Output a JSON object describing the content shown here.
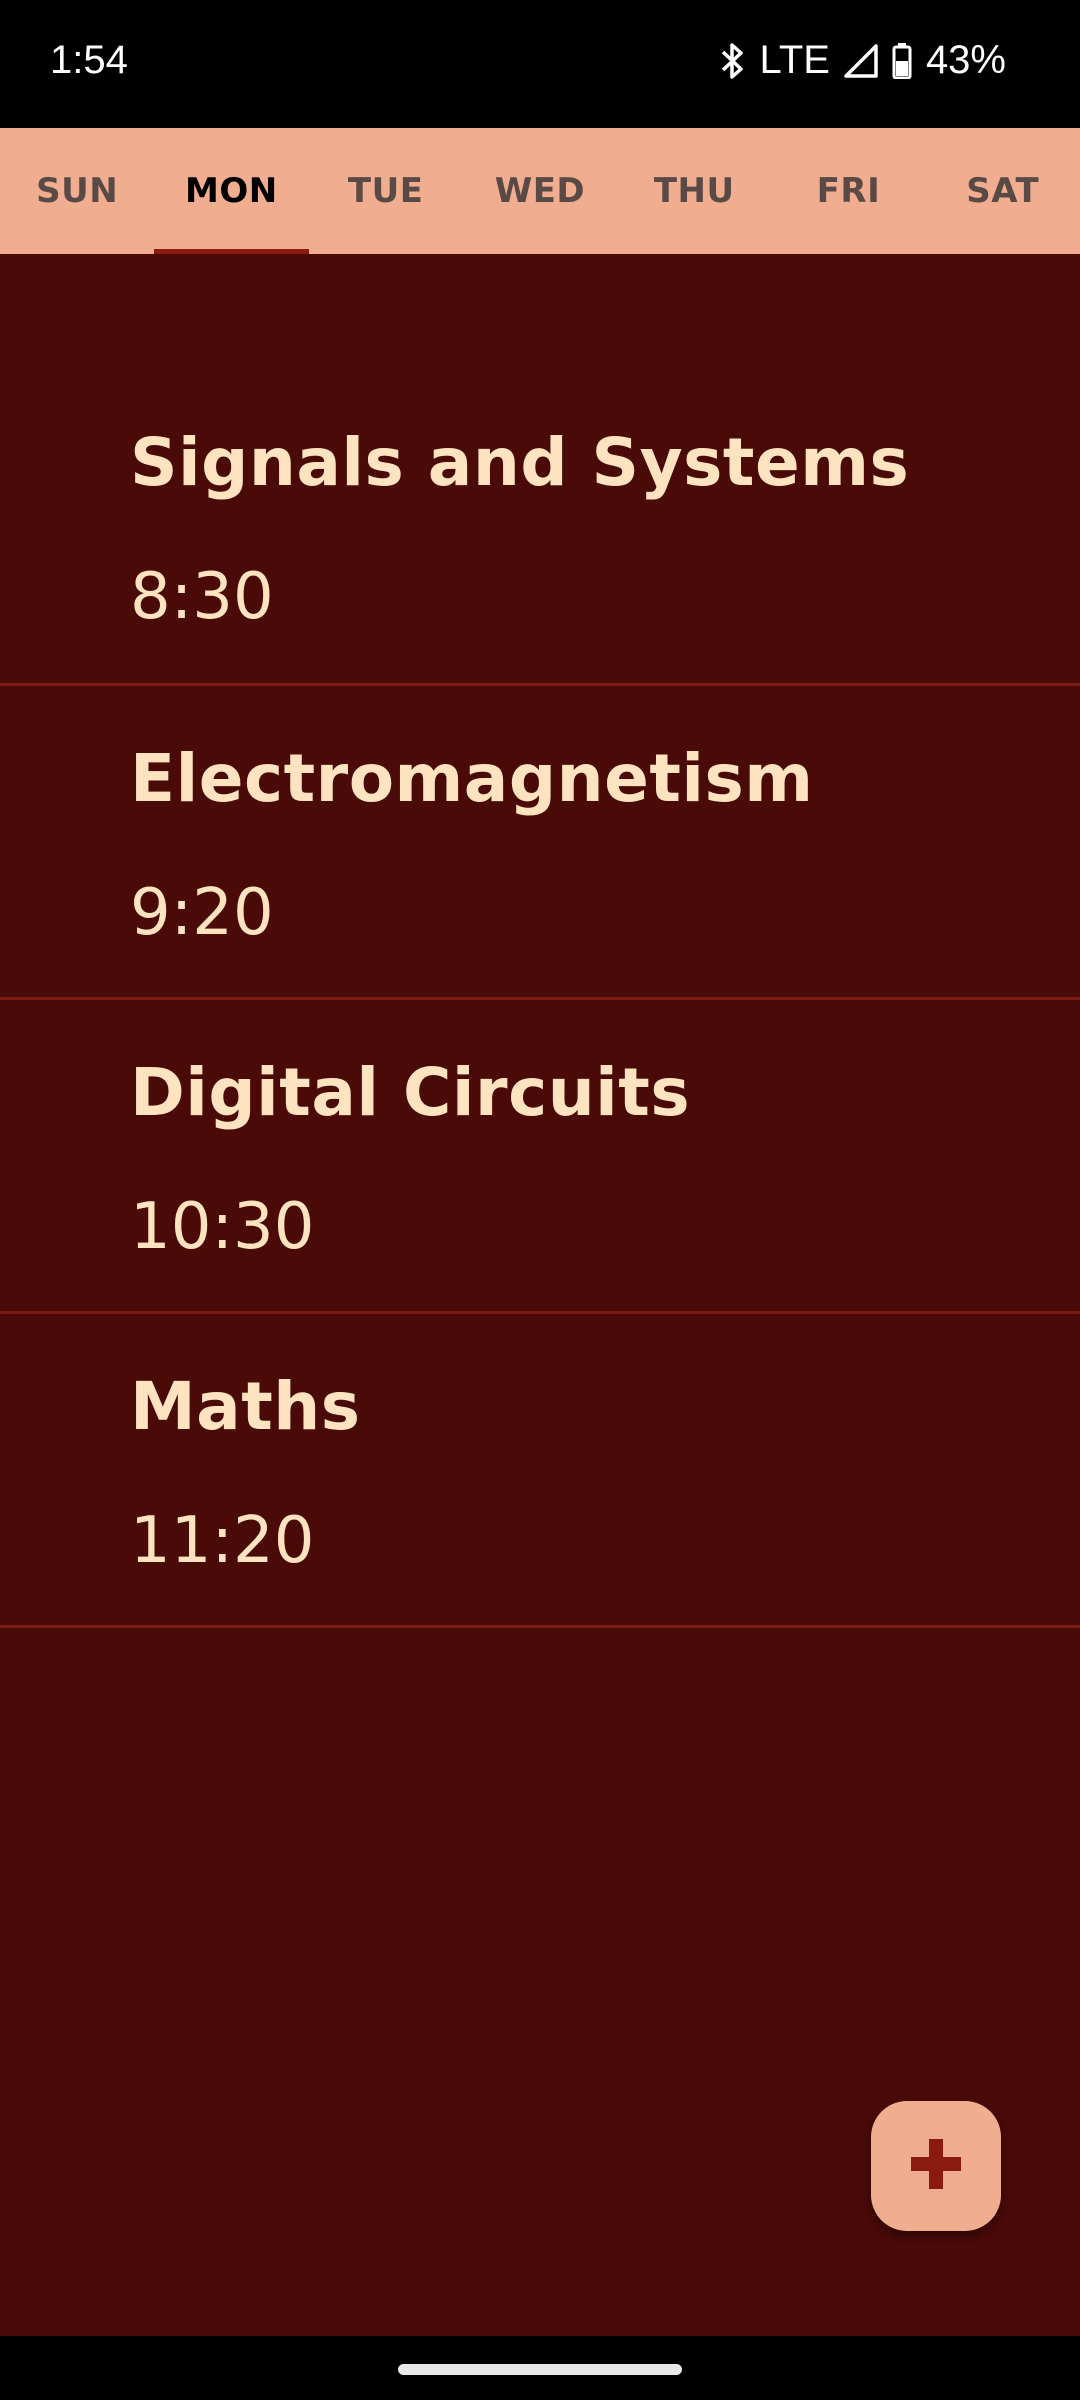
{
  "status_bar": {
    "time": "1:54",
    "network": "LTE",
    "battery": "43%",
    "icons": [
      "bluetooth-icon",
      "signal-icon",
      "battery-icon"
    ]
  },
  "tabs": [
    {
      "label": "SUN"
    },
    {
      "label": "MON",
      "selected": true
    },
    {
      "label": "TUE"
    },
    {
      "label": "WED"
    },
    {
      "label": "THU"
    },
    {
      "label": "FRI"
    },
    {
      "label": "SAT"
    }
  ],
  "classes": [
    {
      "title": "Signals and Systems",
      "time": "8:30"
    },
    {
      "title": "Electromagnetism",
      "time": "9:20"
    },
    {
      "title": "Digital Circuits",
      "time": "10:30"
    },
    {
      "title": "Maths",
      "time": "11:20"
    }
  ],
  "fab": {
    "icon": "plus-icon"
  },
  "colors": {
    "background": "#4a0a08",
    "tab_bar": "#f1ad8f",
    "accent": "#8b1a10",
    "text": "#fde3c0"
  }
}
